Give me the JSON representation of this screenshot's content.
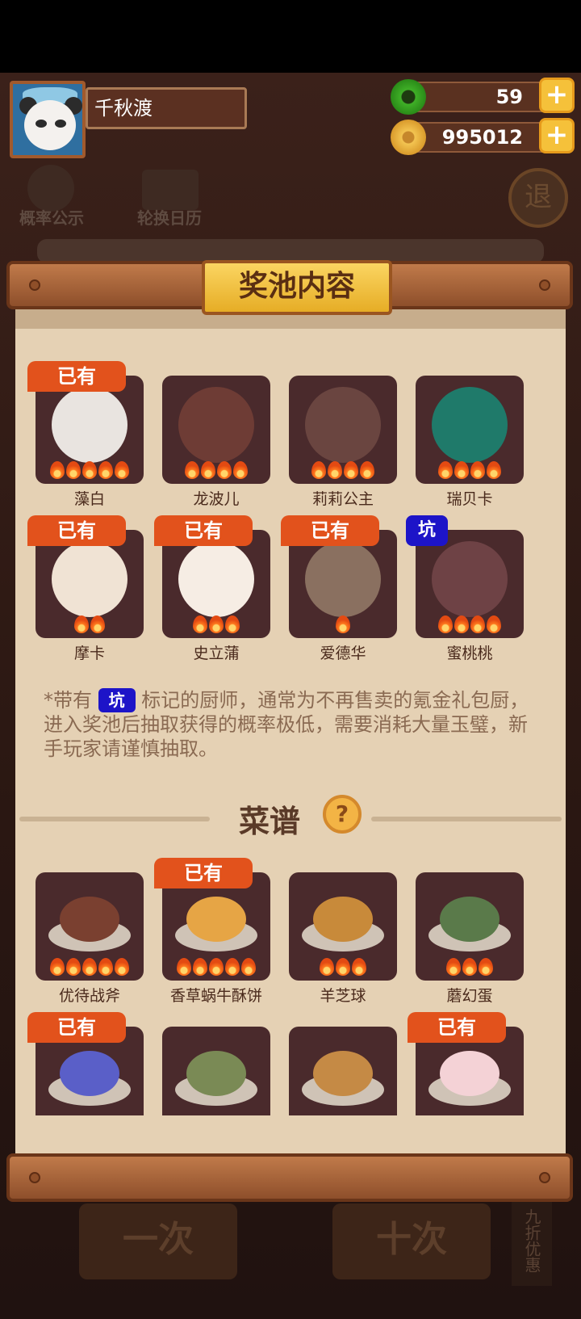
{
  "player": {
    "name": "千秋渡"
  },
  "currency": {
    "jade": "59",
    "coins": "995012",
    "plus": "+"
  },
  "background": {
    "tool1": "概率公示",
    "tool2": "轮换日历",
    "exit": "退",
    "btn_once": "一次",
    "btn_ten": "十次",
    "discount": "九折优惠"
  },
  "panel": {
    "title": "奖池内容",
    "badge_owned": "已有",
    "badge_pit": "坑",
    "note_prefix": "*带有",
    "note_suffix": "标记的厨师，通常为不再售卖的氪金礼包厨，进入奖池后抽取获得的概率极低，需要消耗大量玉璧，新手玩家请谨慎抽取。",
    "recipes_title": "菜谱",
    "help": "?"
  },
  "chefs": [
    {
      "name": "藻白",
      "owned": true,
      "pit": false,
      "stars": 5,
      "color": "#e9e4e0"
    },
    {
      "name": "龙波儿",
      "owned": false,
      "pit": false,
      "stars": 4,
      "color": "#6e3c35"
    },
    {
      "name": "莉莉公主",
      "owned": false,
      "pit": false,
      "stars": 4,
      "color": "#6a4540"
    },
    {
      "name": "瑞贝卡",
      "owned": false,
      "pit": false,
      "stars": 4,
      "color": "#1f7a6a"
    },
    {
      "name": "摩卡",
      "owned": true,
      "pit": false,
      "stars": 2,
      "color": "#f0e3d4"
    },
    {
      "name": "史立蒲",
      "owned": true,
      "pit": false,
      "stars": 3,
      "color": "#f6ede4"
    },
    {
      "name": "爱德华",
      "owned": true,
      "pit": false,
      "stars": 1,
      "color": "#8a7060"
    },
    {
      "name": "蜜桃桃",
      "owned": false,
      "pit": true,
      "stars": 4,
      "color": "#6e4245"
    }
  ],
  "recipes": [
    {
      "name": "优待战斧",
      "owned": false,
      "stars": 5,
      "color": "#7a4030"
    },
    {
      "name": "香草蜗牛酥饼",
      "owned": true,
      "stars": 5,
      "color": "#e6a545"
    },
    {
      "name": "羊芝球",
      "owned": false,
      "stars": 3,
      "color": "#c88a3a"
    },
    {
      "name": "蘑幻蛋",
      "owned": false,
      "stars": 3,
      "color": "#5a7a4a"
    },
    {
      "name": "",
      "owned": true,
      "stars": 0,
      "color": "#5a5fc8"
    },
    {
      "name": "",
      "owned": false,
      "stars": 0,
      "color": "#7a8a55"
    },
    {
      "name": "",
      "owned": false,
      "stars": 0,
      "color": "#c58a45"
    },
    {
      "name": "",
      "owned": true,
      "stars": 0,
      "color": "#f4d2d6"
    }
  ],
  "colors": {
    "owned_badge": "#e2521c",
    "pit_badge": "#1d14c8",
    "card_bg": "#4a2a2c"
  }
}
